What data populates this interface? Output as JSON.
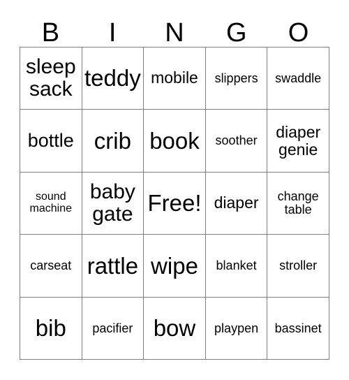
{
  "card": {
    "title_letters": [
      "B",
      "I",
      "N",
      "G",
      "O"
    ],
    "free_space_label": "Free!",
    "border_color": "#808080",
    "text_color": "#000000",
    "background_color": "#ffffff",
    "columns": 5,
    "rows": 5,
    "cells": [
      [
        {
          "text": "sleep sack",
          "lines": [
            "sleep",
            "sack"
          ],
          "size": "xl"
        },
        {
          "text": "teddy",
          "lines": [
            "teddy"
          ],
          "size": "xxl"
        },
        {
          "text": "mobile",
          "lines": [
            "mobile"
          ],
          "size": "md"
        },
        {
          "text": "slippers",
          "lines": [
            "slippers"
          ],
          "size": "sm"
        },
        {
          "text": "swaddle",
          "lines": [
            "swaddle"
          ],
          "size": "sm"
        }
      ],
      [
        {
          "text": "bottle",
          "lines": [
            "bottle"
          ],
          "size": "lg"
        },
        {
          "text": "crib",
          "lines": [
            "crib"
          ],
          "size": "xxl"
        },
        {
          "text": "book",
          "lines": [
            "book"
          ],
          "size": "xxl"
        },
        {
          "text": "soother",
          "lines": [
            "soother"
          ],
          "size": "sm"
        },
        {
          "text": "diaper genie",
          "lines": [
            "diaper",
            "genie"
          ],
          "size": "md"
        }
      ],
      [
        {
          "text": "sound machine",
          "lines": [
            "sound",
            "machine"
          ],
          "size": "xs"
        },
        {
          "text": "baby gate",
          "lines": [
            "baby",
            "gate"
          ],
          "size": "xl"
        },
        {
          "text": "Free!",
          "lines": [
            "Free!"
          ],
          "size": "xxl"
        },
        {
          "text": "diaper",
          "lines": [
            "diaper"
          ],
          "size": "md"
        },
        {
          "text": "change table",
          "lines": [
            "change",
            "table"
          ],
          "size": "sm"
        }
      ],
      [
        {
          "text": "carseat",
          "lines": [
            "carseat"
          ],
          "size": "sm"
        },
        {
          "text": "rattle",
          "lines": [
            "rattle"
          ],
          "size": "xxl"
        },
        {
          "text": "wipe",
          "lines": [
            "wipe"
          ],
          "size": "xxl"
        },
        {
          "text": "blanket",
          "lines": [
            "blanket"
          ],
          "size": "sm"
        },
        {
          "text": "stroller",
          "lines": [
            "stroller"
          ],
          "size": "sm"
        }
      ],
      [
        {
          "text": "bib",
          "lines": [
            "bib"
          ],
          "size": "xxl"
        },
        {
          "text": "pacifier",
          "lines": [
            "pacifier"
          ],
          "size": "sm"
        },
        {
          "text": "bow",
          "lines": [
            "bow"
          ],
          "size": "xxl"
        },
        {
          "text": "playpen",
          "lines": [
            "playpen"
          ],
          "size": "sm"
        },
        {
          "text": "bassinet",
          "lines": [
            "bassinet"
          ],
          "size": "sm"
        }
      ]
    ]
  }
}
